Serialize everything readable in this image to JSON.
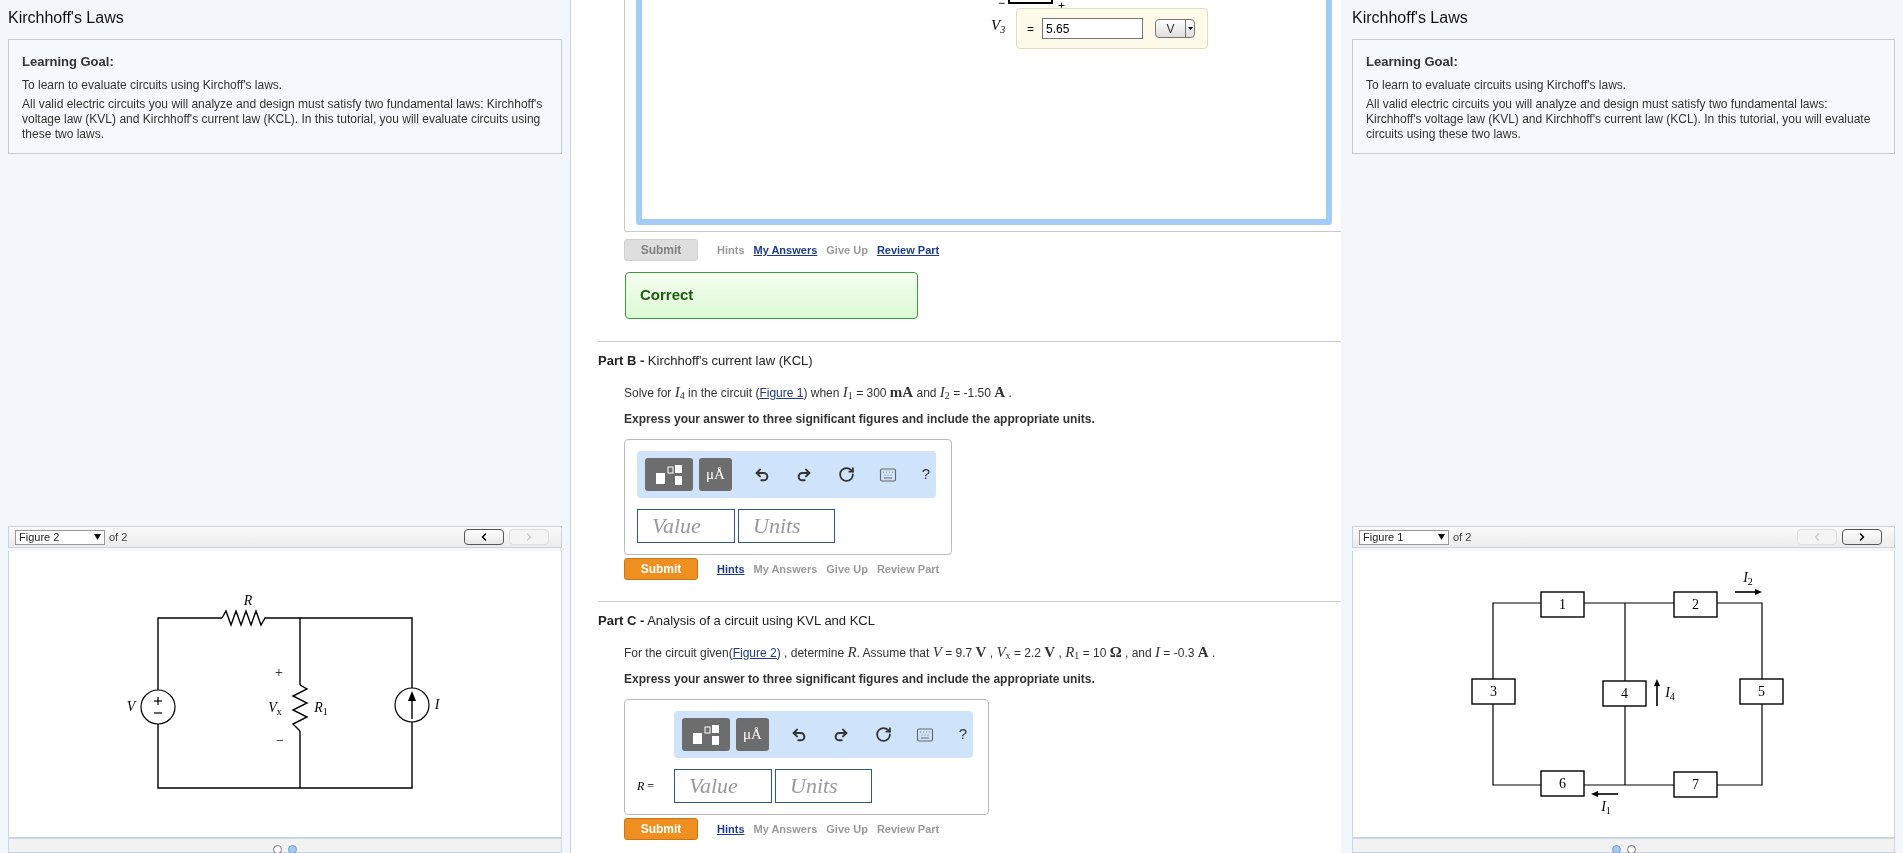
{
  "left_panel": {
    "title": "Kirchhoff's Laws",
    "goal": {
      "heading": "Learning Goal:",
      "paragraphs": [
        "To learn to evaluate circuits using Kirchoff's laws.",
        "All valid electric circuits you will analyze and design must satisfy two fundamental laws: Kirchhoff's voltage law (KVL) and Kirchhoff's current law (KCL). In this tutorial, you will evaluate circuits using these two laws."
      ]
    },
    "figure": {
      "kind": "circuit",
      "select_label": "Figure 2",
      "count": "of 2",
      "prev_enabled": true,
      "next_enabled": false,
      "labels": [
        "*R*",
        "*V*",
        "+",
        "*V*$_{x}$",
        "−",
        "*R*$_{1}$",
        "*I*"
      ],
      "dots": [
        {
          "selected": false
        },
        {
          "selected": true
        }
      ]
    }
  },
  "center": {
    "previous_answer": {
      "signs": [
        "−",
        "+"
      ],
      "variable": "*V*$_{3}$",
      "equals": "=",
      "value": "5.65",
      "unit": "V"
    },
    "previous_actions": {
      "submit": {
        "label": "Submit",
        "enabled": false
      },
      "links": [
        {
          "label": "Hints",
          "enabled": false
        },
        {
          "label": "My Answers",
          "enabled": true
        },
        {
          "label": "Give Up",
          "enabled": false
        },
        {
          "label": "Review Part",
          "enabled": true
        }
      ]
    },
    "feedback": "Correct",
    "parts": [
      {
        "title": "**Part B -** Kirchhoff's current law (KCL)",
        "statement": [
          {
            "kind": "text",
            "text": "Solve for "
          },
          {
            "kind": "math",
            "text": "*I*$_{4}$"
          },
          {
            "kind": "text",
            "text": " in the circuit ("
          },
          {
            "kind": "link",
            "text": "Figure 1"
          },
          {
            "kind": "text",
            "text": ") when "
          },
          {
            "kind": "math",
            "text": "*I*$_{1}$"
          },
          {
            "kind": "text",
            "text": " = 300 "
          },
          {
            "kind": "math",
            "text": "**mA**"
          },
          {
            "kind": "text",
            "text": " and "
          },
          {
            "kind": "math",
            "text": "*I*$_{2}$"
          },
          {
            "kind": "text",
            "text": " = -1.50 "
          },
          {
            "kind": "math",
            "text": "**A**"
          },
          {
            "kind": "text",
            "text": " ."
          }
        ],
        "instruction": "Express your answer to three significant figures and include the appropriate units.",
        "answer": {
          "unit_button": "μÅ",
          "help": "?",
          "value_placeholder": "Value",
          "units_placeholder": "Units"
        },
        "actions": {
          "submit": {
            "label": "Submit",
            "enabled": true
          },
          "links": [
            {
              "label": "Hints",
              "enabled": true
            },
            {
              "label": "My Answers",
              "enabled": false
            },
            {
              "label": "Give Up",
              "enabled": false
            },
            {
              "label": "Review Part",
              "enabled": false
            }
          ]
        }
      },
      {
        "title": "**Part C -** Analysis of a circuit using KVL and KCL",
        "statement": [
          {
            "kind": "text",
            "text": "For the circuit given("
          },
          {
            "kind": "link",
            "text": "Figure 2"
          },
          {
            "kind": "text",
            "text": ") , determine "
          },
          {
            "kind": "math",
            "text": "*R*"
          },
          {
            "kind": "text",
            "text": ". Assume that "
          },
          {
            "kind": "math",
            "text": "*V*"
          },
          {
            "kind": "text",
            "text": " = 9.7 "
          },
          {
            "kind": "math",
            "text": "**V**"
          },
          {
            "kind": "text",
            "text": " , "
          },
          {
            "kind": "math",
            "text": "*V*$_{x}$"
          },
          {
            "kind": "text",
            "text": " = 2.2 "
          },
          {
            "kind": "math",
            "text": "**V**"
          },
          {
            "kind": "text",
            "text": " , "
          },
          {
            "kind": "math",
            "text": "*R*$_{1}$"
          },
          {
            "kind": "text",
            "text": " = 10 "
          },
          {
            "kind": "math",
            "text": "**Ω**"
          },
          {
            "kind": "text",
            "text": " , and "
          },
          {
            "kind": "math",
            "text": "*I*"
          },
          {
            "kind": "text",
            "text": " = -0.3 "
          },
          {
            "kind": "math",
            "text": "**A**"
          },
          {
            "kind": "text",
            "text": " ."
          }
        ],
        "instruction": "Express your answer to three significant figures and include the appropriate units.",
        "answer": {
          "prefix": "*R* =",
          "unit_button": "μÅ",
          "help": "?",
          "value_placeholder": "Value",
          "units_placeholder": "Units"
        },
        "actions": {
          "submit": {
            "label": "Submit",
            "enabled": true
          },
          "links": [
            {
              "label": "Hints",
              "enabled": true
            },
            {
              "label": "My Answers",
              "enabled": false
            },
            {
              "label": "Give Up",
              "enabled": false
            },
            {
              "label": "Review Part",
              "enabled": false
            }
          ]
        }
      }
    ]
  },
  "right_panel": {
    "title": "Kirchhoff's Laws",
    "goal": {
      "heading": "Learning Goal:",
      "paragraphs": [
        "To learn to evaluate circuits using Kirchoff's laws.",
        "All valid electric circuits you will analyze and design must satisfy two fundamental laws: Kirchhoff's voltage law (KVL) and Kirchhoff's current law (KCL). In this tutorial, you will evaluate circuits using these two laws."
      ]
    },
    "figure": {
      "kind": "network",
      "select_label": "Figure 1",
      "count": "of 2",
      "prev_enabled": false,
      "next_enabled": true,
      "labels": [
        "1",
        "2",
        "3",
        "4",
        "5",
        "6",
        "7",
        "*I*$_{2}$",
        "*I*$_{4}$",
        "*I*$_{1}$"
      ],
      "dots": [
        {
          "selected": true
        },
        {
          "selected": false
        }
      ]
    }
  }
}
